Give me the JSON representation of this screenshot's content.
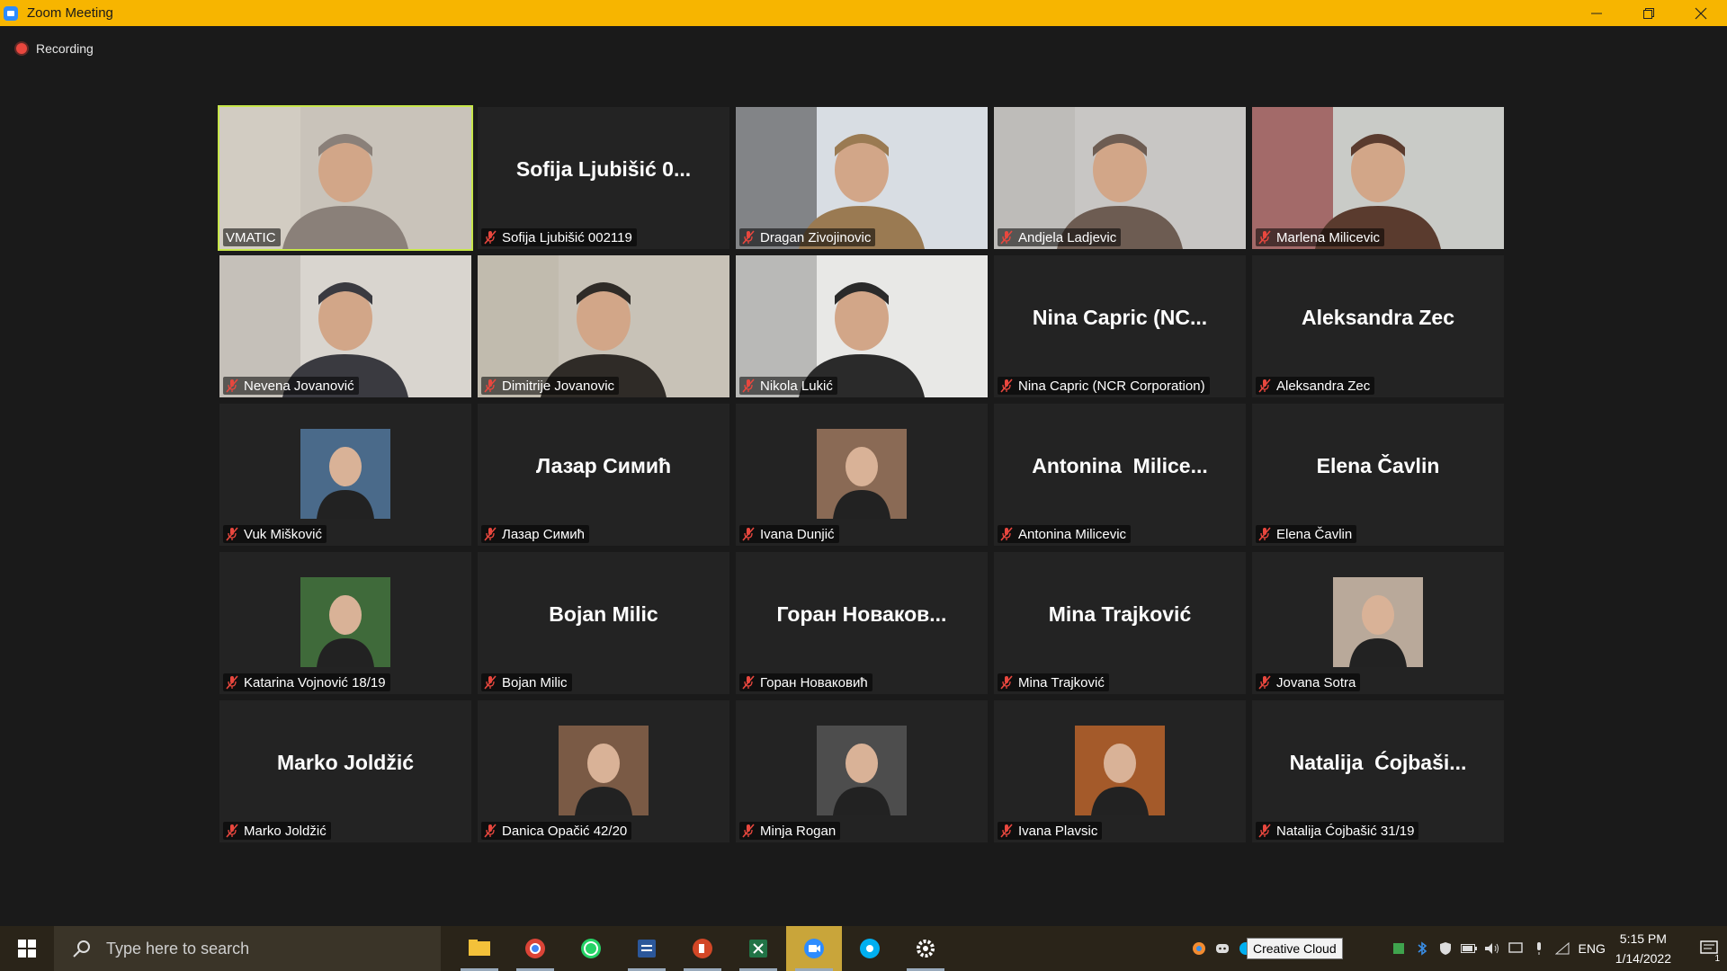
{
  "window": {
    "title": "Zoom Meeting"
  },
  "recording": {
    "label": "Recording"
  },
  "participants": [
    {
      "label": "VMATIC",
      "video": true,
      "active": true,
      "muted": false,
      "scene": "man-older"
    },
    {
      "label": "Sofija Ljubišić 002119",
      "tile_name": "Sofija Ljubišić 0...",
      "muted": true
    },
    {
      "label": "Dragan Zivojinovic",
      "video": true,
      "muted": true,
      "scene": "man-window"
    },
    {
      "label": "Andjela Ladjevic",
      "video": true,
      "muted": true,
      "scene": "woman-room"
    },
    {
      "label": "Marlena Milicevic",
      "video": true,
      "muted": true,
      "scene": "woman-curtain"
    },
    {
      "label": "Nevena Jovanović",
      "video": true,
      "muted": true,
      "scene": "woman-tree"
    },
    {
      "label": "Dimitrije Jovanovic",
      "video": true,
      "muted": true,
      "scene": "man-glasses"
    },
    {
      "label": "Nikola Lukić",
      "video": true,
      "muted": true,
      "scene": "man-bright"
    },
    {
      "label": "Nina Capric (NCR Corporation)",
      "tile_name": "Nina Capric (NC...",
      "muted": true
    },
    {
      "label": "Aleksandra Zec",
      "tile_name": "Aleksandra Zec",
      "muted": true
    },
    {
      "label": "Vuk Mišković",
      "avatar": true,
      "muted": true,
      "avatar_color": "#4a6a8a"
    },
    {
      "label": "Лазар Симић",
      "tile_name": "Лазар Симић",
      "muted": true
    },
    {
      "label": "Ivana Dunjić",
      "avatar": true,
      "muted": true,
      "avatar_color": "#8a6a55"
    },
    {
      "label": "Antonina Milicevic",
      "tile_name": "Antonina  Milice...",
      "muted": true
    },
    {
      "label": "Elena Čavlin",
      "tile_name": "Elena Čavlin",
      "muted": true
    },
    {
      "label": "Katarina Vojnović 18/19",
      "avatar": true,
      "muted": true,
      "avatar_color": "#3f6a3a"
    },
    {
      "label": "Bojan Milic",
      "tile_name": "Bojan Milic",
      "muted": true
    },
    {
      "label": "Горан Новаковић",
      "tile_name": "Горан Новаков...",
      "muted": true
    },
    {
      "label": "Mina Trajković",
      "tile_name": "Mina Trajković",
      "muted": true
    },
    {
      "label": "Jovana Sotra",
      "avatar": true,
      "muted": true,
      "avatar_color": "#b9a99a"
    },
    {
      "label": "Marko Joldžić",
      "tile_name": "Marko Joldžić",
      "muted": true
    },
    {
      "label": "Danica Opačić 42/20",
      "avatar": true,
      "muted": true,
      "avatar_color": "#7a5a45"
    },
    {
      "label": "Minja Rogan",
      "avatar": true,
      "muted": true,
      "avatar_color": "#4d4d4d"
    },
    {
      "label": "Ivana Plavsic",
      "avatar": true,
      "muted": true,
      "avatar_color": "#a45a2a"
    },
    {
      "label": "Natalija Ćojbašić 31/19",
      "tile_name": "Natalija  Ćojbaši...",
      "muted": true
    }
  ],
  "taskbar": {
    "search_placeholder": "Type here to search",
    "apps": [
      {
        "name": "file-explorer",
        "color": "#f3c13a",
        "open": true
      },
      {
        "name": "chrome",
        "color": "#db4437",
        "open": true
      },
      {
        "name": "whatsapp",
        "color": "#25d366",
        "open": false
      },
      {
        "name": "word",
        "color": "#2b579a",
        "open": true
      },
      {
        "name": "powerpoint",
        "color": "#d24726",
        "open": true
      },
      {
        "name": "excel",
        "color": "#217346",
        "open": true
      },
      {
        "name": "zoom",
        "color": "#2d8cff",
        "open": true,
        "active": true
      },
      {
        "name": "skype",
        "color": "#00aff0",
        "open": false
      },
      {
        "name": "settings",
        "color": "#ffffff",
        "open": true
      }
    ],
    "tooltip": "Creative Cloud",
    "language": "ENG",
    "time": "5:15 PM",
    "date": "1/14/2022",
    "notifications": "1"
  }
}
